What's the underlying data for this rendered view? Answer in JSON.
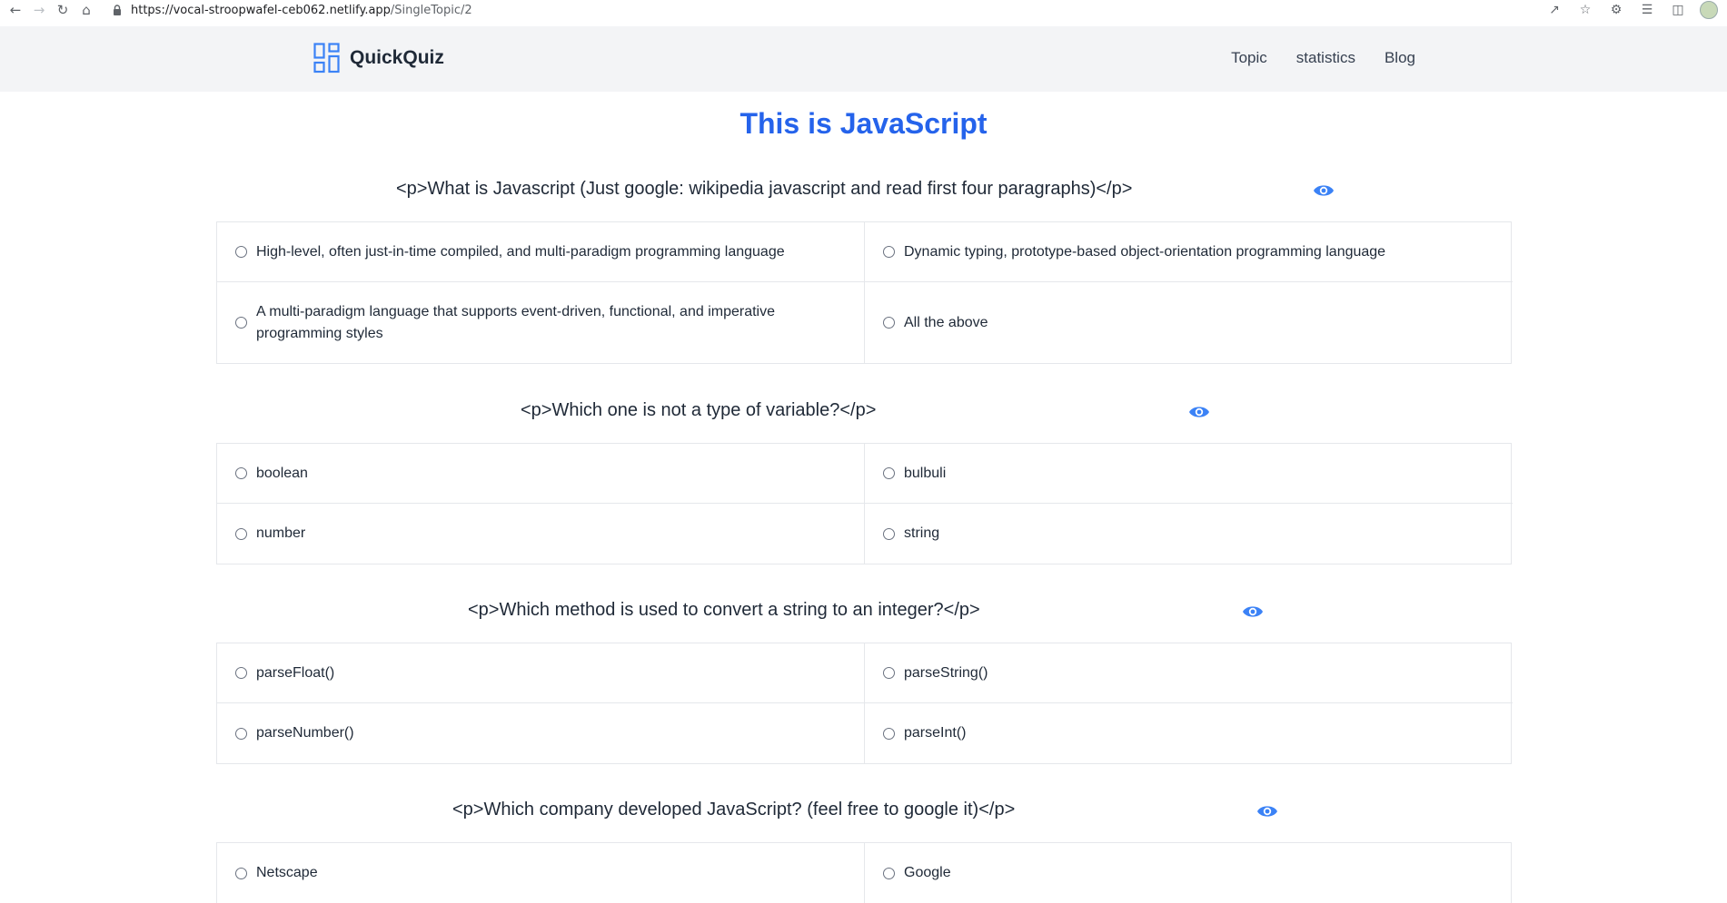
{
  "browser": {
    "url_host": "https://vocal-stroopwafel-ceb062.netlify.app",
    "url_path": "/SingleTopic/2"
  },
  "header": {
    "brand": "QuickQuiz",
    "nav": [
      "Topic",
      "statistics",
      "Blog"
    ]
  },
  "page_title": "This is JavaScript",
  "colors": {
    "accent": "#2563eb",
    "header_bg": "#f3f4f6",
    "eye": "#3b82f6"
  },
  "questions": [
    {
      "text": "<p>What is Javascript (Just google: wikipedia javascript and read first four paragraphs)</p>",
      "options": [
        "High-level, often just-in-time compiled, and multi-paradigm programming language",
        "Dynamic typing, prototype-based object-orientation programming language",
        "A multi-paradigm language that supports event-driven, functional, and imperative programming styles",
        "All the above"
      ]
    },
    {
      "text": "<p>Which one is not a type of variable?</p>",
      "options": [
        "boolean",
        "bulbuli",
        "number",
        "string"
      ]
    },
    {
      "text": "<p>Which method is used to convert a string to an integer?</p>",
      "options": [
        "parseFloat()",
        "parseString()",
        "parseNumber()",
        "parseInt()"
      ]
    },
    {
      "text": "<p>Which company developed JavaScript? (feel free to google it)</p>",
      "options": [
        "Netscape",
        "Google"
      ]
    }
  ]
}
